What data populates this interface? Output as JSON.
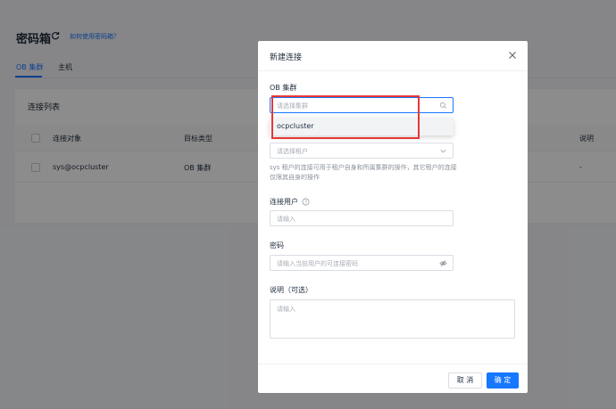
{
  "page": {
    "title": "密码箱",
    "help_link": "如何使用密码箱？",
    "tabs": [
      {
        "label": "OB 集群"
      },
      {
        "label": "主机"
      }
    ]
  },
  "connection_list": {
    "title": "连接列表",
    "columns": [
      "连接对象",
      "目标类型",
      "说明"
    ],
    "rows": [
      {
        "object": "sys@ocpcluster",
        "type": "OB 集群",
        "note": "-"
      }
    ]
  },
  "modal": {
    "title": "新建连接",
    "cluster_label": "OB 集群",
    "cluster_placeholder": "请选择集群",
    "cluster_options": [
      "ocpcluster"
    ],
    "tenant_placeholder": "请选择租户",
    "tenant_hint": "sys 租户的连接可用于租户自身和所属集群的操作，其它租户的连接仅限其自身的操作",
    "user_label": "连接用户",
    "user_placeholder": "请输入",
    "password_label": "密码",
    "password_placeholder": "请输入当前用户的可连接密码",
    "note_label": "说明（可选）",
    "note_placeholder": "请输入",
    "cancel_label": "取 消",
    "ok_label": "确 定"
  },
  "icons": {
    "refresh": "refresh-icon",
    "close": "close-icon",
    "search": "search-icon",
    "chevron": "chevron-down-icon",
    "eye": "eye-off-icon",
    "help": "question-circle-icon"
  },
  "colors": {
    "accent": "#1677ff",
    "highlight": "#e53935"
  }
}
